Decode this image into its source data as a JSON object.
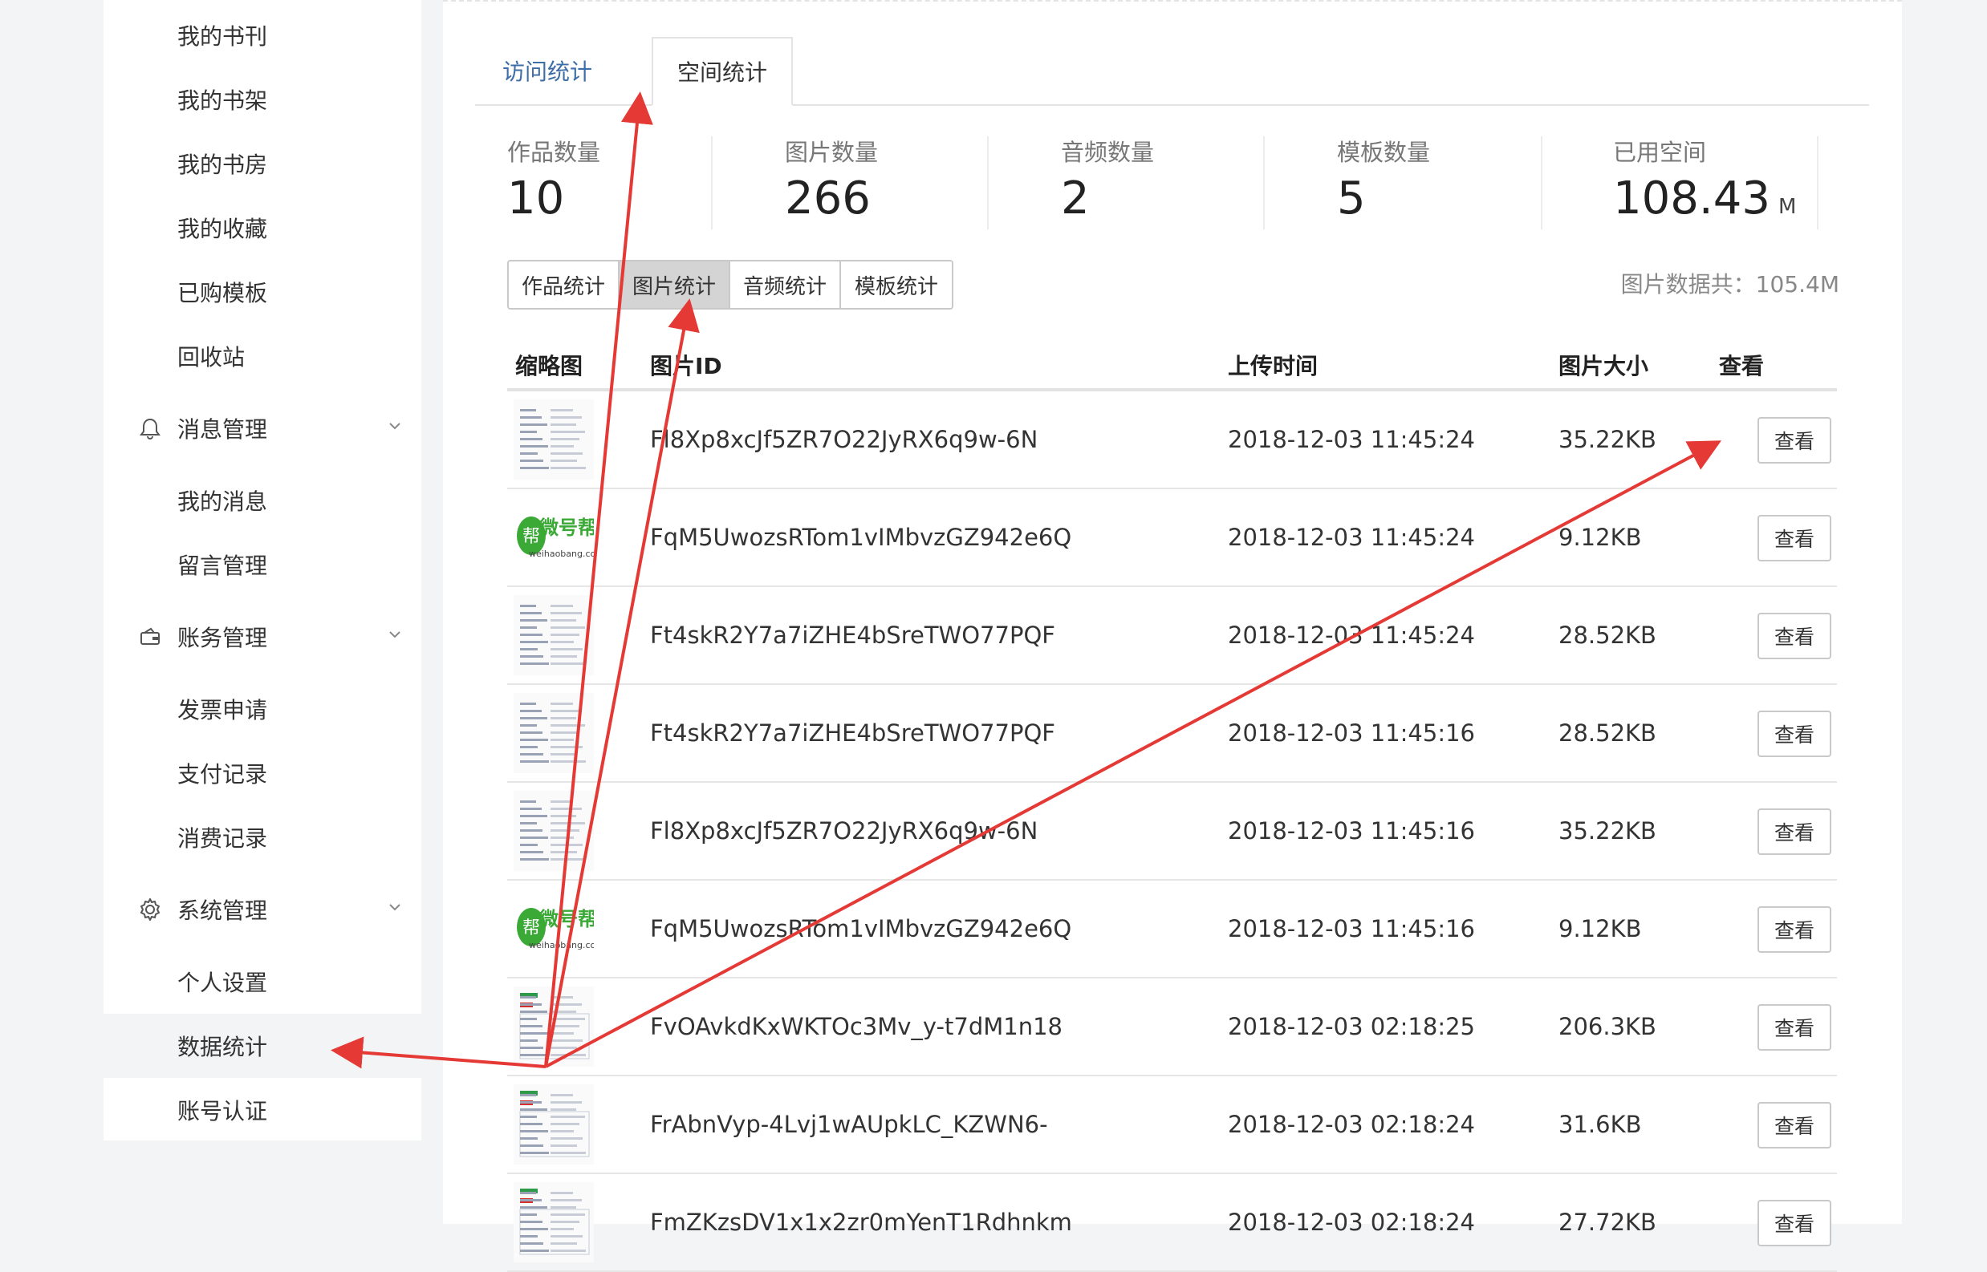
{
  "sidebar": {
    "items_top": [
      "我的书刊",
      "我的书架",
      "我的书房",
      "我的收藏",
      "已购模板",
      "回收站"
    ],
    "group_messages": {
      "label": "消息管理",
      "items": [
        "我的消息",
        "留言管理"
      ]
    },
    "group_finance": {
      "label": "账务管理",
      "items": [
        "发票申请",
        "支付记录",
        "消费记录"
      ]
    },
    "group_system": {
      "label": "系统管理",
      "items": [
        "个人设置",
        "数据统计",
        "账号认证"
      ],
      "active": "数据统计"
    }
  },
  "tabs": [
    "访问统计",
    "空间统计"
  ],
  "stats": [
    {
      "label": "作品数量",
      "value": "10"
    },
    {
      "label": "图片数量",
      "value": "266"
    },
    {
      "label": "音频数量",
      "value": "2"
    },
    {
      "label": "模板数量",
      "value": "5"
    },
    {
      "label": "已用空间",
      "value": "108.43",
      "unit": "M"
    }
  ],
  "filters": [
    "作品统计",
    "图片统计",
    "音频统计",
    "模板统计"
  ],
  "selected_filter": "图片统计",
  "picture_total": "图片数据共：105.4M",
  "table": {
    "headers": [
      "缩略图",
      "图片ID",
      "上传时间",
      "图片大小",
      "查看"
    ],
    "rows": [
      {
        "thumb": "document-thumbnail",
        "id": "Fl8Xp8xcJf5ZR7O22JyRX6q9w-6N",
        "time": "2018-12-03 11:45:24",
        "size": "35.22KB",
        "action": "查看"
      },
      {
        "thumb": "weihaobang-logo-thumbnail",
        "id": "FqM5UwozsRTom1vIMbvzGZ942e6Q",
        "time": "2018-12-03 11:45:24",
        "size": "9.12KB",
        "action": "查看"
      },
      {
        "thumb": "form-thumbnail",
        "id": "Ft4skR2Y7a7iZHE4bSreTWO77PQF",
        "time": "2018-12-03 11:45:24",
        "size": "28.52KB",
        "action": "查看"
      },
      {
        "thumb": "form-thumbnail",
        "id": "Ft4skR2Y7a7iZHE4bSreTWO77PQF",
        "time": "2018-12-03 11:45:16",
        "size": "28.52KB",
        "action": "查看"
      },
      {
        "thumb": "document-thumbnail",
        "id": "Fl8Xp8xcJf5ZR7O22JyRX6q9w-6N",
        "time": "2018-12-03 11:45:16",
        "size": "35.22KB",
        "action": "查看"
      },
      {
        "thumb": "weihaobang-logo-thumbnail",
        "id": "FqM5UwozsRTom1vIMbvzGZ942e6Q",
        "time": "2018-12-03 11:45:16",
        "size": "9.12KB",
        "action": "查看"
      },
      {
        "thumb": "report-thumbnail",
        "id": "FvOAvkdKxWKTOc3Mv_y-t7dM1n18",
        "time": "2018-12-03 02:18:25",
        "size": "206.3KB",
        "action": "查看"
      },
      {
        "thumb": "report-thumbnail",
        "id": "FrAbnVyp-4Lvj1wAUpkLC_KZWN6-",
        "time": "2018-12-03 02:18:24",
        "size": "31.6KB",
        "action": "查看"
      },
      {
        "thumb": "report-thumbnail",
        "id": "FmZKzsDV1x1x2zr0mYenT1Rdhnkm",
        "time": "2018-12-03 02:18:24",
        "size": "27.72KB",
        "action": "查看"
      }
    ]
  },
  "thumb_logo_text": {
    "brand": "微号帮",
    "badge": "帮",
    "url": "weihaobang.com"
  },
  "colors": {
    "accent_tab": "#3d6ea8",
    "annotation_arrow": "#e53935",
    "logo_green": "#3aa935"
  }
}
